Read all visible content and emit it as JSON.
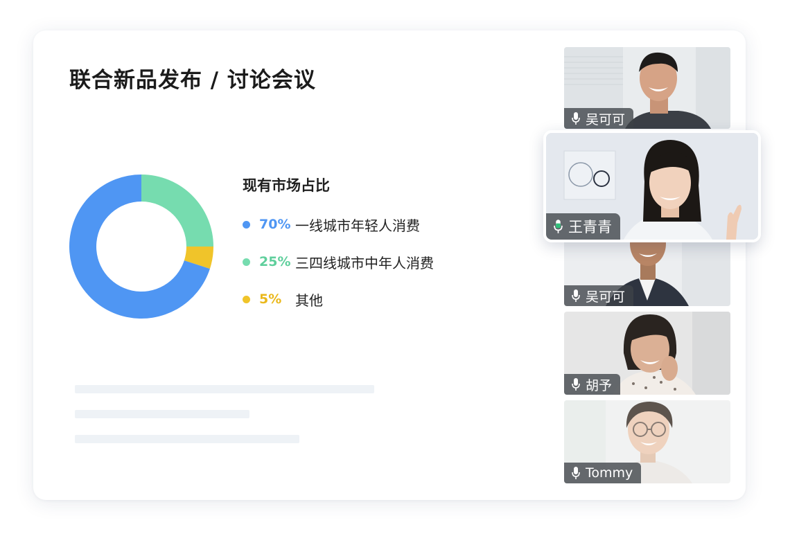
{
  "meeting": {
    "title": "联合新品发布 / 讨论会议"
  },
  "market_share": {
    "title": "现有市场占比",
    "items": [
      {
        "percent_label": "70%",
        "value": 70,
        "label": "一线城市年轻人消费",
        "color": "#4f96f3"
      },
      {
        "percent_label": "25%",
        "value": 25,
        "label": "三四线城市中年人消费",
        "color": "#76dcaf"
      },
      {
        "percent_label": "5%",
        "value": 5,
        "label": "其他",
        "color": "#f0c42a"
      }
    ]
  },
  "participants": [
    {
      "name": "吴可可",
      "speaking": false,
      "icon": "microphone-icon"
    },
    {
      "name": "王青青",
      "speaking": true,
      "icon": "microphone-active-icon",
      "active_color": "#2fc07a"
    },
    {
      "name": "吴可可",
      "speaking": false,
      "icon": "microphone-icon"
    },
    {
      "name": "胡予",
      "speaking": false,
      "icon": "microphone-icon"
    },
    {
      "name": "Tommy",
      "speaking": false,
      "icon": "microphone-icon"
    }
  ]
}
